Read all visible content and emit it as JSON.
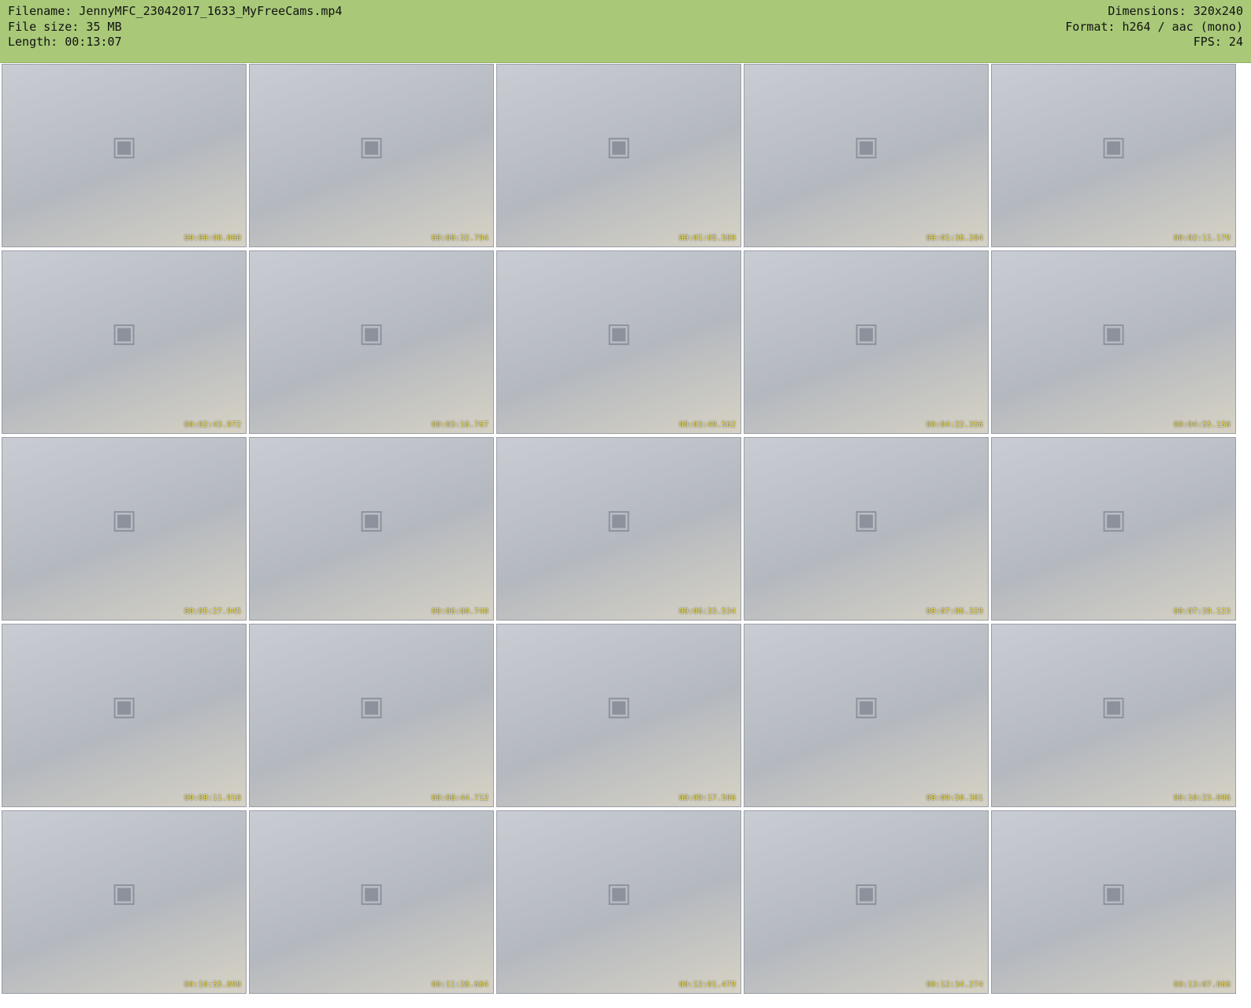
{
  "header": {
    "filename_line": "Filename: JennyMFC_23042017_1633_MyFreeCams.mp4",
    "filesize_line": "File size: 35 MB",
    "length_line": "Length: 00:13:07",
    "dimensions_line": "Dimensions: 320x240",
    "format_line": "Format: h264 / aac (mono)",
    "fps_line": "FPS: 24"
  },
  "frames": [
    {
      "timestamp": "00:00:00.000"
    },
    {
      "timestamp": "00:00:32.794"
    },
    {
      "timestamp": "00:01:05.589"
    },
    {
      "timestamp": "00:01:38.284"
    },
    {
      "timestamp": "00:02:11.179"
    },
    {
      "timestamp": "00:02:43.972"
    },
    {
      "timestamp": "00:03:16.767"
    },
    {
      "timestamp": "00:03:49.562"
    },
    {
      "timestamp": "00:04:22.356"
    },
    {
      "timestamp": "00:04:55.150"
    },
    {
      "timestamp": "00:05:27.945"
    },
    {
      "timestamp": "00:06:00.740"
    },
    {
      "timestamp": "00:06:33.534"
    },
    {
      "timestamp": "00:07:06.329"
    },
    {
      "timestamp": "00:07:39.123"
    },
    {
      "timestamp": "00:08:11.918"
    },
    {
      "timestamp": "00:08:44.712"
    },
    {
      "timestamp": "00:09:17.506"
    },
    {
      "timestamp": "00:09:50.301"
    },
    {
      "timestamp": "00:10:23.096"
    },
    {
      "timestamp": "00:10:55.890"
    },
    {
      "timestamp": "00:11:28.684"
    },
    {
      "timestamp": "00:12:01.479"
    },
    {
      "timestamp": "00:12:34.274"
    },
    {
      "timestamp": "00:13:07.068"
    }
  ],
  "icons": {
    "thumbnail": "image-placeholder-icon"
  }
}
